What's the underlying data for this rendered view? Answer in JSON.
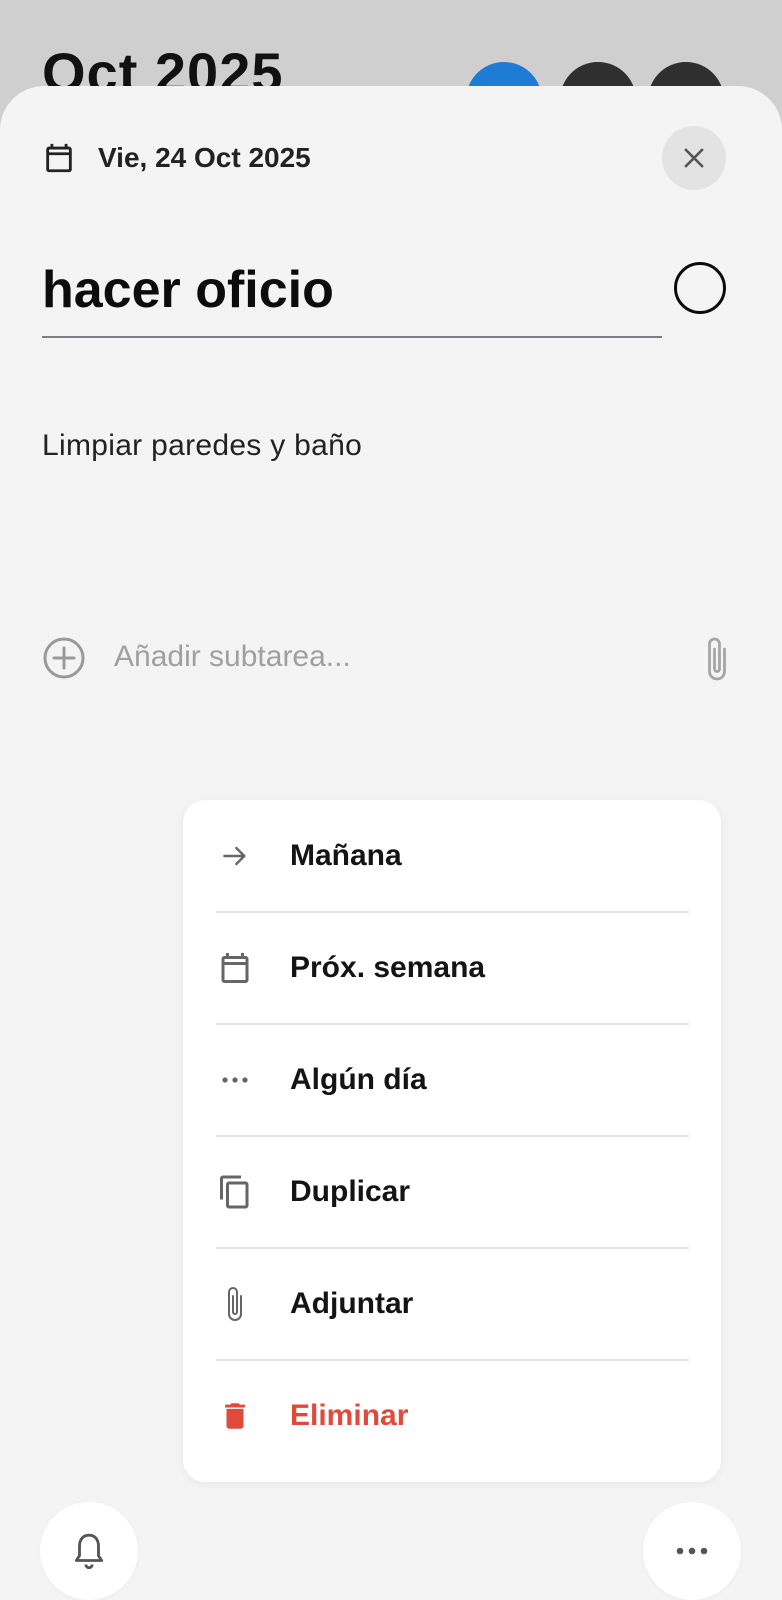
{
  "background": {
    "title": "Oct 2025"
  },
  "sheet": {
    "date_label": "Vie, 24 Oct 2025",
    "task_title": "hacer oficio",
    "notes": "Limpiar paredes y baño",
    "subtask_placeholder": "Añadir subtarea..."
  },
  "menu": {
    "items": [
      {
        "label": "Mañana",
        "icon": "arrow-right-icon"
      },
      {
        "label": "Próx. semana",
        "icon": "calendar-icon"
      },
      {
        "label": "Algún día",
        "icon": "more-horizontal-icon"
      },
      {
        "label": "Duplicar",
        "icon": "copy-icon"
      },
      {
        "label": "Adjuntar",
        "icon": "paperclip-icon"
      },
      {
        "label": "Eliminar",
        "icon": "trash-icon",
        "color": "#e04a3c"
      }
    ]
  },
  "fabs": {
    "left_icon": "bell-icon",
    "right_icon": "more-horizontal-icon"
  },
  "colors": {
    "accent_blue": "#1e7bd6",
    "danger": "#e04a3c",
    "sheet_bg": "#f4f4f4"
  }
}
